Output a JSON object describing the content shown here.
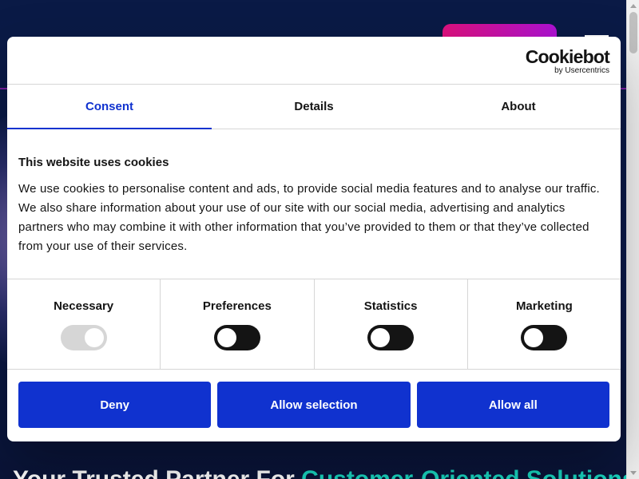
{
  "background": {
    "headline_start": "Your Trusted Partner For ",
    "headline_accent": "Customer-Oriented Solutions"
  },
  "dialog": {
    "logo": {
      "main": "Cookiebot",
      "sub": "by Usercentrics"
    },
    "tabs": [
      {
        "label": "Consent",
        "active": true
      },
      {
        "label": "Details",
        "active": false
      },
      {
        "label": "About",
        "active": false
      }
    ],
    "title": "This website uses cookies",
    "text": "We use cookies to personalise content and ads, to provide social media features and to analyse our traffic. We also share information about your use of our site with our social media, advertising and analytics partners who may combine it with other information that you’ve provided to them or that they’ve collected from your use of their services.",
    "toggles": [
      {
        "label": "Necessary",
        "state": "on-disabled"
      },
      {
        "label": "Preferences",
        "state": "off"
      },
      {
        "label": "Statistics",
        "state": "off"
      },
      {
        "label": "Marketing",
        "state": "off"
      }
    ],
    "buttons": {
      "deny": "Deny",
      "allow_selection": "Allow selection",
      "allow_all": "Allow all"
    },
    "colors": {
      "accent": "#1032cf",
      "text": "#141414",
      "toggle_off": "#141414",
      "toggle_disabled": "#d6d6d6"
    }
  }
}
